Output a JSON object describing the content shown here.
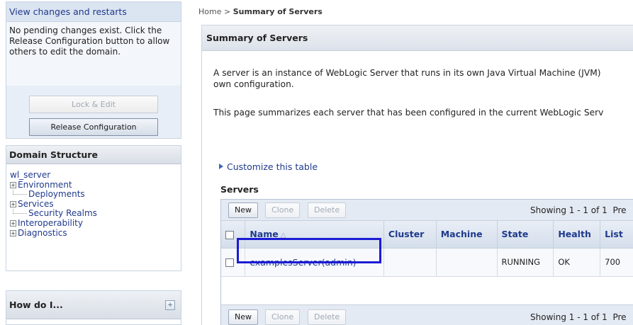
{
  "change_center": {
    "title": "View changes and restarts",
    "message": "No pending changes exist. Click the Release Configuration button to allow others to edit the domain.",
    "lock_edit_label": "Lock & Edit",
    "release_config_label": "Release Configuration"
  },
  "domain_structure": {
    "title": "Domain Structure",
    "root": "wl_server",
    "items": [
      {
        "label": "Environment",
        "expandable": true
      },
      {
        "label": "Deployments",
        "expandable": false
      },
      {
        "label": "Services",
        "expandable": true
      },
      {
        "label": "Security Realms",
        "expandable": false
      },
      {
        "label": "Interoperability",
        "expandable": true
      },
      {
        "label": "Diagnostics",
        "expandable": true
      }
    ]
  },
  "how_do_i": {
    "title": "How do I...",
    "toggle_icon": "expand-icon"
  },
  "breadcrumb": {
    "home": "Home",
    "separator": ">",
    "current": "Summary of Servers"
  },
  "main": {
    "title": "Summary of Servers",
    "desc_line1": "A server is an instance of WebLogic Server that runs in its own Java Virtual Machine (JVM)",
    "desc_line2": "own configuration.",
    "desc_line3": "This page summarizes each server that has been configured in the current WebLogic Serv",
    "customize_label": "Customize this table",
    "servers_title": "Servers"
  },
  "table": {
    "new_label": "New",
    "clone_label": "Clone",
    "delete_label": "Delete",
    "showing_text": "Showing 1 - 1 of 1",
    "prev_text": "Pre",
    "headers": {
      "name": "Name",
      "cluster": "Cluster",
      "machine": "Machine",
      "state": "State",
      "health": "Health",
      "listen": "List"
    },
    "rows": [
      {
        "name": "examplesServer(admin)",
        "cluster": "",
        "machine": "",
        "state": "RUNNING",
        "health": "OK",
        "listen": "700"
      }
    ]
  },
  "colors": {
    "link": "#1f3a8c",
    "highlight_border": "#1b1bd6",
    "panel_bg": "#e8eef7"
  }
}
